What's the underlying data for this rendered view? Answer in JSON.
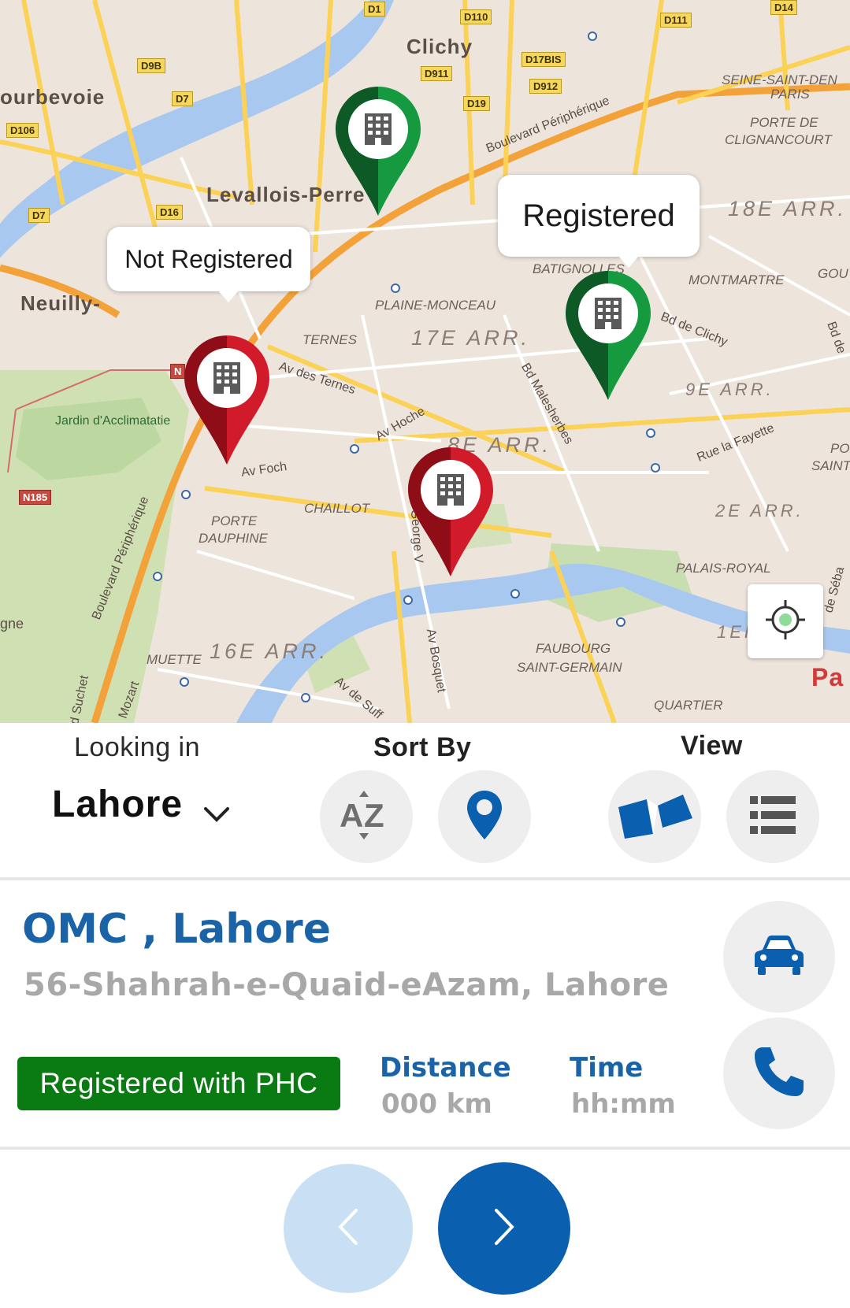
{
  "map": {
    "labels": {
      "clichy": "Clichy",
      "courbevoie": "ourbevoie",
      "levallois": "Levallois-Perre",
      "neuilly": "Neuilly-",
      "seine_saint_denis": "SEINE-SAINT-DEN",
      "paris_small": "PARIS",
      "porte_clignancourt_1": "PORTE DE",
      "porte_clignancourt_2": "CLIGNANCOURT",
      "arr18": "18E ARR.",
      "arr17": "17E ARR.",
      "arr9": "9E ARR.",
      "arr8": "8E ARR.",
      "arr2": "2E ARR.",
      "arr16": "16E ARR.",
      "arr1": "1ER",
      "montmartre": "MONTMARTRE",
      "plaine_monceau": "PLAINE-MONCEAU",
      "ternes": "TERNES",
      "batignolles": "BATIGNOLLES",
      "chaillot": "CHAILLOT",
      "porte_dauphine_1": "PORTE",
      "porte_dauphine_2": "DAUPHINE",
      "muette": "MUETTE",
      "palais_royal": "PALAIS-ROYAL",
      "faubourg_1": "FAUBOURG",
      "faubourg_2": "SAINT-GERMAIN",
      "quartier": "QUARTIER",
      "jardin": "Jardin d'Acclimatatie",
      "bd_peripherique_north": "Boulevard Périphérique",
      "bd_peripherique_west": "Boulevard Périphérique",
      "av_des_ternes": "Av des Ternes",
      "av_hoche": "Av Hoche",
      "av_foch": "Av Foch",
      "bd_malesherbes": "Bd Malesherbes",
      "bd_de_clichy": "Bd de Clichy",
      "rue_la_fayette": "Rue la Fayette",
      "av_bosquet": "Av Bosquet",
      "av_george_v": "George V",
      "av_de_suffren": "Av de Suff",
      "mozart": "Mozart",
      "suchet": "d Suchet",
      "pa": "Pa",
      "gne": "gne",
      "gou": "GOU",
      "po": "PO",
      "saint": "SAINT",
      "bd_de": "Bd de",
      "de_seb": "de Séba"
    },
    "road_shields": [
      "D1",
      "D110",
      "D111",
      "D14",
      "D9B",
      "D911",
      "D17BIS",
      "D912",
      "D19",
      "D7",
      "D106",
      "D7",
      "D16",
      "N185",
      "N"
    ],
    "pins": [
      {
        "status": "registered",
        "color": "#0f7a2e"
      },
      {
        "status": "registered",
        "color": "#0f7a2e"
      },
      {
        "status": "not-registered",
        "color": "#c8102e"
      },
      {
        "status": "not-registered",
        "color": "#c8102e"
      }
    ],
    "bubbles": {
      "not_registered": "Not Registered",
      "registered": "Registered"
    },
    "locate_icon": "crosshair-icon"
  },
  "controls": {
    "looking_in_label": "Looking in",
    "city": "Lahore",
    "sort_by_label": "Sort By",
    "view_label": "View",
    "sort_az_icon": "sort-az-icon",
    "sort_location_icon": "location-pin-icon",
    "view_map_icon": "map-icon",
    "view_list_icon": "list-icon"
  },
  "place": {
    "name": "OMC , Lahore",
    "address": "56-Shahrah-e-Quaid-eAzam, Lahore",
    "status": "Registered with PHC",
    "distance_label": "Distance",
    "distance_value": "000 km",
    "time_label": "Time",
    "time_value": "hh:mm"
  },
  "colors": {
    "brand_blue": "#1a63a6",
    "registered_green": "#0a7a12",
    "not_registered_red": "#c8102e",
    "next_button": "#0a5fae",
    "prev_button_disabled": "#c9dff3"
  }
}
